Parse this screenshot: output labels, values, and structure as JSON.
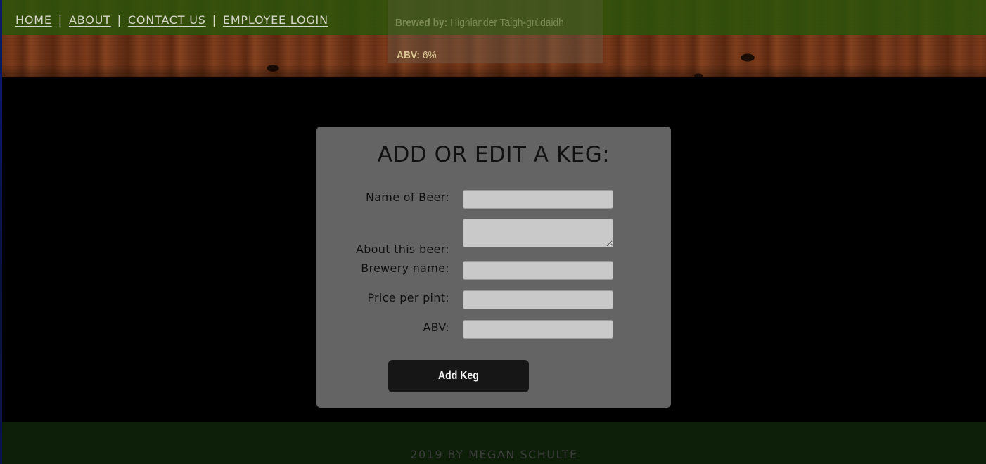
{
  "nav": {
    "items": [
      {
        "label": "HOME"
      },
      {
        "label": "ABOUT"
      },
      {
        "label": "CONTACT US"
      },
      {
        "label": "EMPLOYEE LOGIN"
      }
    ],
    "separator": "|"
  },
  "featured_keg": {
    "brewed_by_label": "Brewed by:",
    "brewed_by_value": "Highlander Taigh-grùdaidh",
    "abv_label": "ABV:",
    "abv_value": "6%"
  },
  "form": {
    "title": "ADD OR EDIT A KEG:",
    "fields": {
      "name": {
        "label": "Name of Beer:",
        "value": ""
      },
      "about": {
        "label": "About this beer:",
        "value": ""
      },
      "brewery": {
        "label": "Brewery name:",
        "value": ""
      },
      "price": {
        "label": "Price per pint:",
        "value": ""
      },
      "abv": {
        "label": "ABV:",
        "value": ""
      }
    },
    "submit_label": "Add Keg"
  },
  "footer": {
    "text": "2019 BY MEGAN SCHULTE"
  },
  "colors": {
    "page_background": "#000000",
    "header_green_band": "#28550a",
    "panel_background": "#646464",
    "input_background": "#c9c9c9",
    "button_background": "#161616",
    "footer_background": "#0d1f09",
    "abv_text": "#d6c58e"
  }
}
